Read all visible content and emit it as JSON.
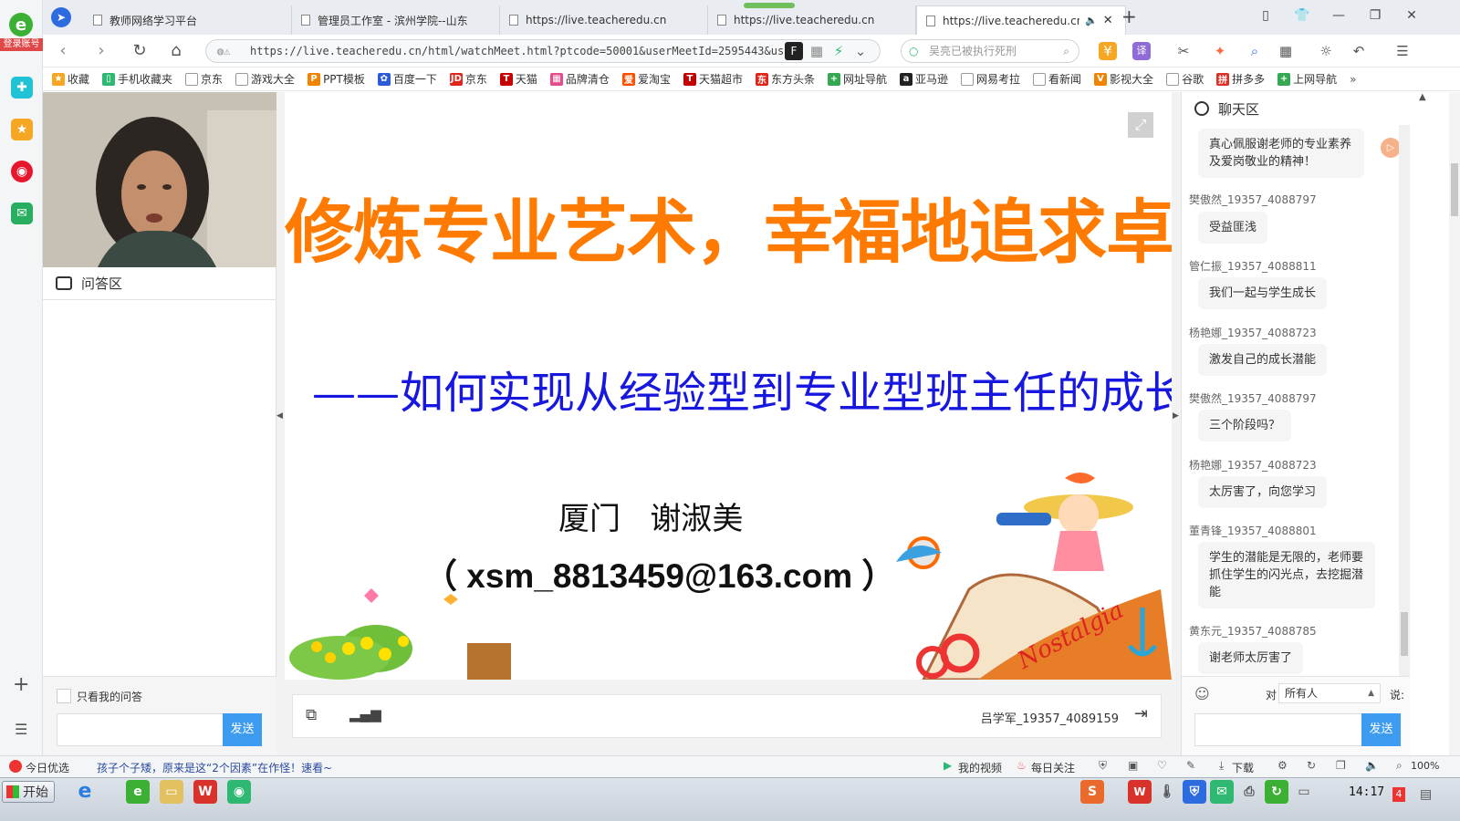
{
  "browser": {
    "login_label": "登录账号",
    "tabs": [
      {
        "title": "教师网络学习平台"
      },
      {
        "title": "管理员工作室 - 滨州学院--山东"
      },
      {
        "title": "https://live.teacheredu.cn"
      },
      {
        "title": "https://live.teacheredu.cn"
      },
      {
        "title": "https://live.teacheredu.cn"
      }
    ],
    "new_tab": "+",
    "url": "https://live.teacheredu.cn/html/watchMeet.html?ptcode=50001&userMeetId=2595443&userI",
    "search_placeholder": "吴亮已被执行死刑"
  },
  "bookmarks": [
    {
      "label": "收藏",
      "color": "#f5a623",
      "glyph": "★"
    },
    {
      "label": "手机收藏夹",
      "color": "#2eb872",
      "glyph": "▯"
    },
    {
      "label": "京东",
      "color": "#ffffff",
      "glyph": ""
    },
    {
      "label": "游戏大全",
      "color": "#ffffff",
      "glyph": ""
    },
    {
      "label": "PPT模板",
      "color": "#f08300",
      "glyph": "P"
    },
    {
      "label": "百度一下",
      "color": "#2d5bd8",
      "glyph": "✿"
    },
    {
      "label": "京东",
      "color": "#e1251b",
      "glyph": "JD"
    },
    {
      "label": "天猫",
      "color": "#c40000",
      "glyph": "T"
    },
    {
      "label": "品牌清仓",
      "color": "#e54c8b",
      "glyph": "▦"
    },
    {
      "label": "爱淘宝",
      "color": "#ff5000",
      "glyph": "爱"
    },
    {
      "label": "天猫超市",
      "color": "#c40000",
      "glyph": "T"
    },
    {
      "label": "东方头条",
      "color": "#e1251b",
      "glyph": "东"
    },
    {
      "label": "网址导航",
      "color": "#34a853",
      "glyph": "+"
    },
    {
      "label": "亚马逊",
      "color": "#222222",
      "glyph": "a"
    },
    {
      "label": "网易考拉",
      "color": "#ffffff",
      "glyph": ""
    },
    {
      "label": "看新闻",
      "color": "#ffffff",
      "glyph": ""
    },
    {
      "label": "影视大全",
      "color": "#f08300",
      "glyph": "V"
    },
    {
      "label": "谷歌",
      "color": "#ffffff",
      "glyph": ""
    },
    {
      "label": "拼多多",
      "color": "#e02e24",
      "glyph": "拼"
    },
    {
      "label": "上网导航",
      "color": "#34a853",
      "glyph": "+"
    }
  ],
  "bookmarks_more": "»",
  "qa": {
    "title": "问答区",
    "only_mine_label": "只看我的问答",
    "send_label": "发送"
  },
  "slide": {
    "title": "修炼专业艺术，幸福地追求卓越",
    "subtitle": "——如何实现从经验型到专业型班主任的成长",
    "author": "厦门   谢淑美",
    "email": "（ xsm_8813459@163.com ）",
    "boat_sign": "Nostalgia"
  },
  "controls": {
    "user": "吕学军_19357_4089159"
  },
  "chat": {
    "title": "聊天区",
    "messages": [
      {
        "name": "",
        "text": "真心佩服谢老师的专业素养及爱岗敬业的精神！"
      },
      {
        "name": "樊傲然_19357_4088797",
        "text": "受益匪浅"
      },
      {
        "name": "管仁振_19357_4088811",
        "text": "我们一起与学生成长"
      },
      {
        "name": "杨艳娜_19357_4088723",
        "text": "激发自己的成长潜能"
      },
      {
        "name": "樊傲然_19357_4088797",
        "text": "三个阶段吗？"
      },
      {
        "name": "杨艳娜_19357_4088723",
        "text": "太厉害了，向您学习"
      },
      {
        "name": "董青锋_19357_4088801",
        "text": "学生的潜能是无限的，老师要抓住学生的闪光点，去挖掘潜能"
      },
      {
        "name": "黄东元_19357_4088785",
        "text": "谢老师太厉害了"
      }
    ],
    "to_label": "对",
    "recipient": "所有人",
    "say_label": "说:",
    "send_label": "发送"
  },
  "statusbar": {
    "news_source": "今日优选",
    "headline": "孩子个子矮，原来是这“2个因素”在作怪！速看~",
    "my_video": "我的视频",
    "daily_follow": "每日关注",
    "download": "下载",
    "zoom": "100%"
  },
  "taskbar": {
    "start_label": "开始",
    "clock": "14:17",
    "notification_count": "4"
  }
}
